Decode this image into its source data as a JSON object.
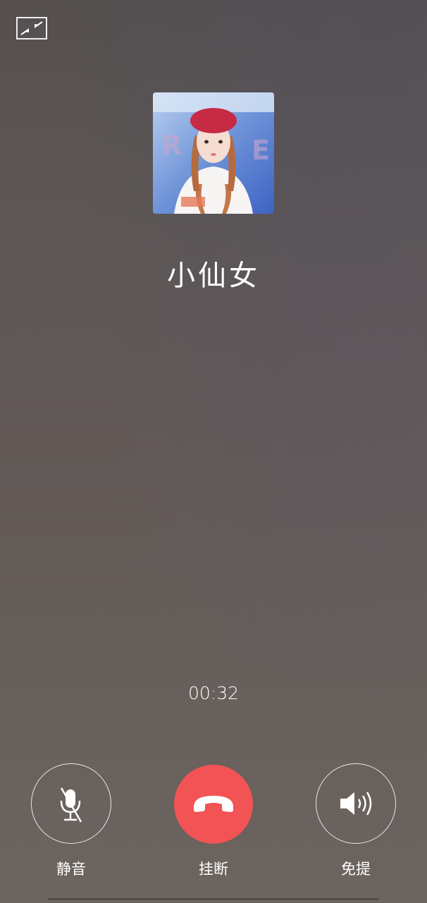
{
  "call": {
    "caller_name": "小仙女",
    "duration": "00:32"
  },
  "controls": {
    "mute_label": "静音",
    "hangup_label": "挂断",
    "speaker_label": "免提"
  },
  "icons": {
    "minimize": "minimize-window-icon",
    "mute": "microphone-muted-icon",
    "hangup": "phone-hangup-icon",
    "speaker": "speaker-icon"
  },
  "colors": {
    "hangup": "#f25354",
    "text": "#ffffff"
  }
}
